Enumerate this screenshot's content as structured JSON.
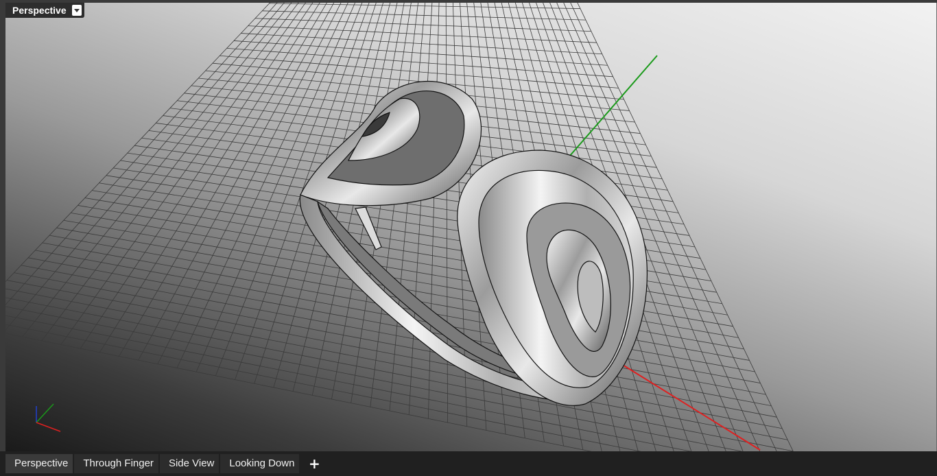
{
  "viewport": {
    "title": "Perspective",
    "dropdown_icon": "chevron-down-icon"
  },
  "tabs": [
    {
      "label": "Perspective",
      "active": true
    },
    {
      "label": "Through Finger",
      "active": false
    },
    {
      "label": "Side View",
      "active": false
    },
    {
      "label": "Looking Down",
      "active": false
    }
  ],
  "add_tab_label": "+",
  "colors": {
    "x_axis": "#e02020",
    "y_axis": "#1a9a1a",
    "grid": "#3a3a3a",
    "tab_bar": "#202020",
    "title_bg": "#2d2d2d"
  },
  "scene_icons": [
    "ring-model",
    "construction-grid",
    "world-axes-icon"
  ]
}
